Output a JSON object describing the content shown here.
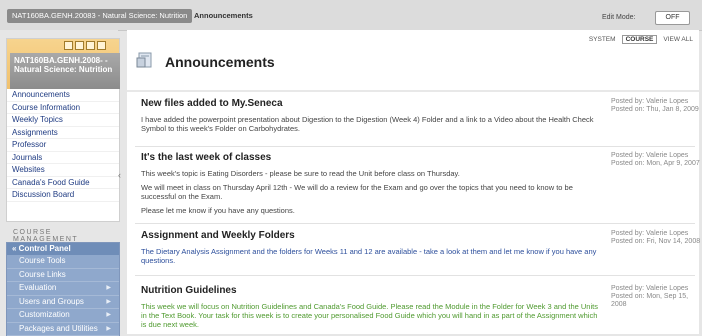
{
  "breadcrumb": {
    "course": "NAT160BA.GENH.20083 - Natural Science: Nutrition",
    "page": "Announcements"
  },
  "edit_mode": {
    "label": "Edit Mode:",
    "state": "OFF"
  },
  "course_menu": {
    "title": "NAT160BA.GENH.2008‑ - Natural Science: Nutrition",
    "items": [
      "Announcements",
      "Course Information",
      "Weekly Topics",
      "Assignments",
      "Professor",
      "Journals",
      "Websites",
      "Canada's Food Guide",
      "Discussion Board"
    ]
  },
  "course_management": {
    "label": "COURSE MANAGEMENT",
    "control_panel": "Control Panel",
    "items": [
      "Course Tools",
      "Course Links",
      "Evaluation",
      "Users and Groups",
      "Customization",
      "Packages and Utilities"
    ]
  },
  "view_tabs": [
    "SYSTEM",
    "COURSE",
    "VIEW ALL"
  ],
  "page_title": "Announcements",
  "announcements": [
    {
      "title": "New files added to My.Seneca",
      "body": [
        "I have added the powerpoint presentation about Digestion to the Digestion (Week 4) Folder and a link to a Video about the Health Check Symbol to this week's Folder on Carbohydrates."
      ],
      "posted_by": "Posted by: Valerie Lopes",
      "posted_on": "Posted on: Thu, Jan 8, 2009"
    },
    {
      "title": "It's the last week of classes",
      "body": [
        "This week's topic is Eating Disorders - please be sure to read the Unit before class on Thursday.",
        "We will meet in class on Thursday April 12th - We will do a review for the Exam and go over the topics that you need to know to be successful on the Exam.",
        "Please let me know if you have any questions."
      ],
      "posted_by": "Posted by: Valerie Lopes",
      "posted_on": "Posted on: Mon, Apr 9, 2007"
    },
    {
      "title": "Assignment and Weekly Folders",
      "body": [
        "The Dietary Analysis Assignment and the folders for Weeks 11 and 12 are available - take a look at them and let me know if you have any questions."
      ],
      "posted_by": "Posted by: Valerie Lopes",
      "posted_on": "Posted on: Fri, Nov 14, 2008"
    },
    {
      "title": "Nutrition Guidelines",
      "body": [
        "This week we will focus on Nutrition Guidelines and Canada's Food Guide. Please read the Module in the Folder for Week 3 and the Units in the Text Book. Your task for this week is to create your personalised Food Guide which you will hand in as part of the Assignment which is due next week."
      ],
      "posted_by": "Posted by: Valerie Lopes",
      "posted_on": "Posted on: Mon, Sep 15, 2008"
    }
  ],
  "colors": {
    "body_blue": "#2d4f9c",
    "body_green": "#4f9a2f",
    "menu_link": "#1f3b82",
    "control_panel": "#8fa8cc"
  }
}
